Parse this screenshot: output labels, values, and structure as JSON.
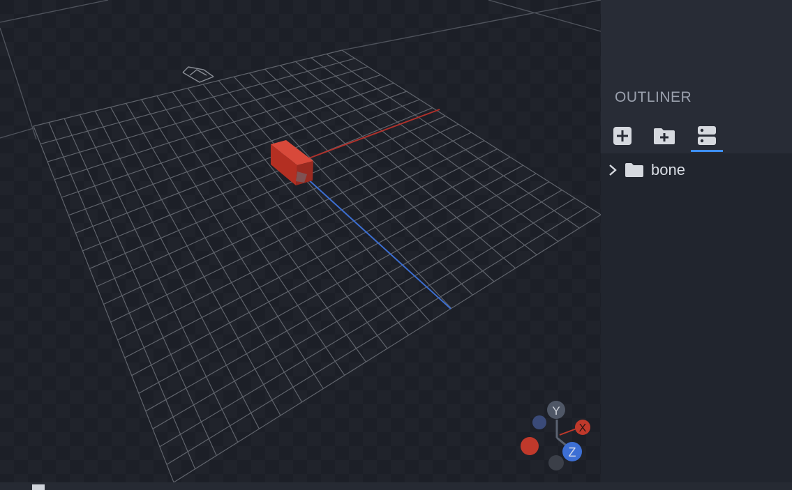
{
  "viewport": {
    "grid_color": "#5c6068",
    "axis_x_color": "#b0312b",
    "axis_z_color": "#3c6ed0",
    "cube_color": "#c23527"
  },
  "gizmo": {
    "y_label": "Y",
    "x_label": "X",
    "z_label": "Z",
    "y_color": "#4f5766",
    "x_color": "#c0392b",
    "z_color": "#3d6fd4"
  },
  "outliner": {
    "title": "OUTLINER",
    "tools": [
      {
        "name": "add-cube",
        "icon": "plus-square-icon"
      },
      {
        "name": "add-group",
        "icon": "folder-plus-icon"
      },
      {
        "name": "toggle-view",
        "icon": "server-icon"
      }
    ],
    "items": [
      {
        "label": "bone",
        "icon": "folder-icon"
      }
    ],
    "accent": "#3e90ff"
  }
}
